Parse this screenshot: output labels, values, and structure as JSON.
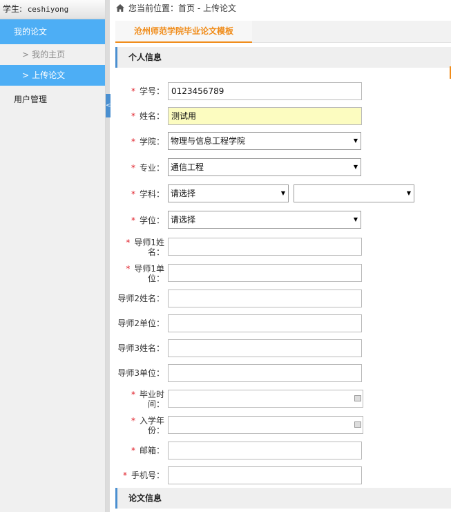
{
  "sidebar": {
    "user_label": "学生:",
    "user_name": "ceshiyong",
    "group_thesis": "我的论文",
    "item_home": "我的主页",
    "item_upload": "上传论文",
    "group_users": "用户管理",
    "chevron": ">",
    "collapse_glyph": "<"
  },
  "breadcrumb": {
    "text": "您当前位置：首页 - 上传论文",
    "icon": "home-icon"
  },
  "tab": {
    "title": "沧州师范学院毕业论文模板"
  },
  "sections": {
    "personal": "个人信息",
    "thesis": "论文信息"
  },
  "form": {
    "student_id": {
      "label": "学号：",
      "value": "0123456789"
    },
    "name": {
      "label": "姓名：",
      "value": "测试用"
    },
    "college": {
      "label": "学院：",
      "value": "物理与信息工程学院"
    },
    "major": {
      "label": "专业：",
      "value": "通信工程"
    },
    "discipline": {
      "label": "学科：",
      "value": "请选择",
      "value2": ""
    },
    "degree": {
      "label": "学位：",
      "value": "请选择"
    },
    "advisor1_name": {
      "label_line1": "导师1姓",
      "label_line2": "名：",
      "value": ""
    },
    "advisor1_unit": {
      "label_line1": "导师1单",
      "label_line2": "位：",
      "value": ""
    },
    "advisor2_name": {
      "label": "导师2姓名：",
      "value": ""
    },
    "advisor2_unit": {
      "label": "导师2单位：",
      "value": ""
    },
    "advisor3_name": {
      "label": "导师3姓名：",
      "value": ""
    },
    "advisor3_unit": {
      "label": "导师3单位：",
      "value": ""
    },
    "grad_time": {
      "label_line1": "毕业时",
      "label_line2": "间：",
      "value": ""
    },
    "entry_year": {
      "label_line1": "入学年",
      "label_line2": "份：",
      "value": ""
    },
    "email": {
      "label": "邮箱：",
      "value": ""
    },
    "phone": {
      "label": "手机号：",
      "value": ""
    },
    "required_mark": "*",
    "dropdown_arrow": "▼"
  },
  "colors": {
    "sidebar_active": "#4daef5",
    "accent_orange": "#f08c1a",
    "required_red": "#e0202a",
    "highlight_field": "#fcfcc0"
  }
}
